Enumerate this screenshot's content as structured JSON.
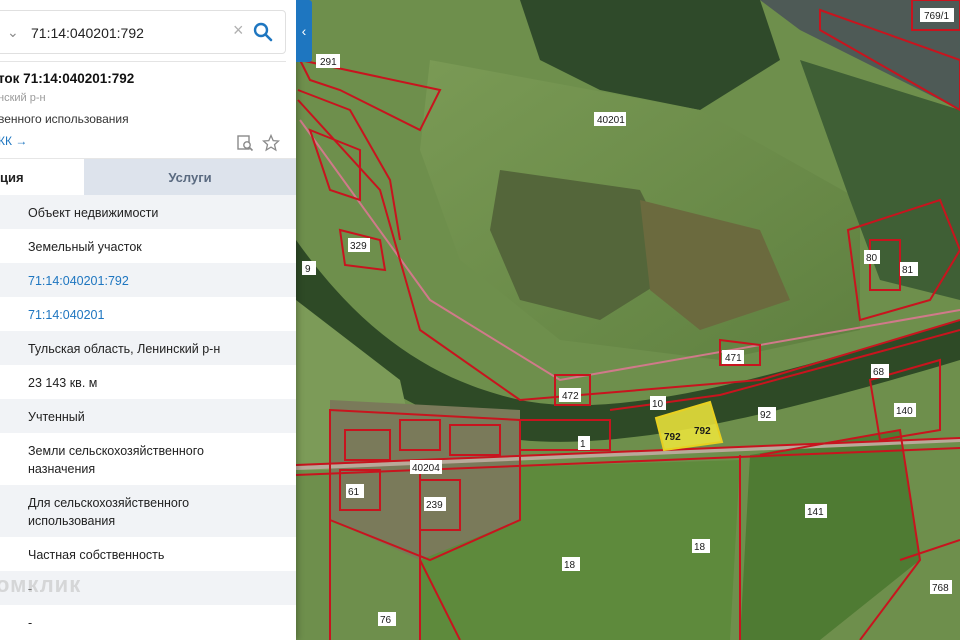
{
  "search": {
    "value": "71:14:040201:792"
  },
  "header": {
    "title": "ток 71:14:040201:792",
    "region": "нский р-н",
    "usage": "венного использования",
    "link": "КК →"
  },
  "tabs": [
    {
      "label": "ция"
    },
    {
      "label": "Услуги"
    }
  ],
  "rows": [
    {
      "value": "Объект недвижимости"
    },
    {
      "value": "Земельный участок"
    },
    {
      "value": "71:14:040201:792"
    },
    {
      "value": "71:14:040201"
    },
    {
      "value": "Тульская область, Ленинский р-н"
    },
    {
      "value": "23 143 кв. м"
    },
    {
      "value": "Учтенный"
    },
    {
      "value": "Земли сельскохозяйственного назначения"
    },
    {
      "value": "Для сельскохозяйственного использования"
    },
    {
      "value": "Частная собственность"
    },
    {
      "value": "-"
    },
    {
      "value": "-"
    }
  ],
  "watermark": "омклик",
  "map_labels": {
    "l1": "769/1",
    "l2": "291",
    "l3": "40201",
    "l4": "329",
    "l5": "9",
    "l6": "80",
    "l7": "81",
    "l8": "471",
    "l9": "68",
    "l10": "472",
    "l11": "10",
    "l12": "792",
    "l13": "792",
    "l14": "92",
    "l15": "140",
    "l16": "40204",
    "l17": "61",
    "l18": "239",
    "l19": "141",
    "l20": "18",
    "l21": "18",
    "l22": "768",
    "l23": "76",
    "l24": "1"
  },
  "colors": {
    "accent": "#1e76c0",
    "boundary": "#c8141e",
    "selected": "#f0e83c"
  }
}
